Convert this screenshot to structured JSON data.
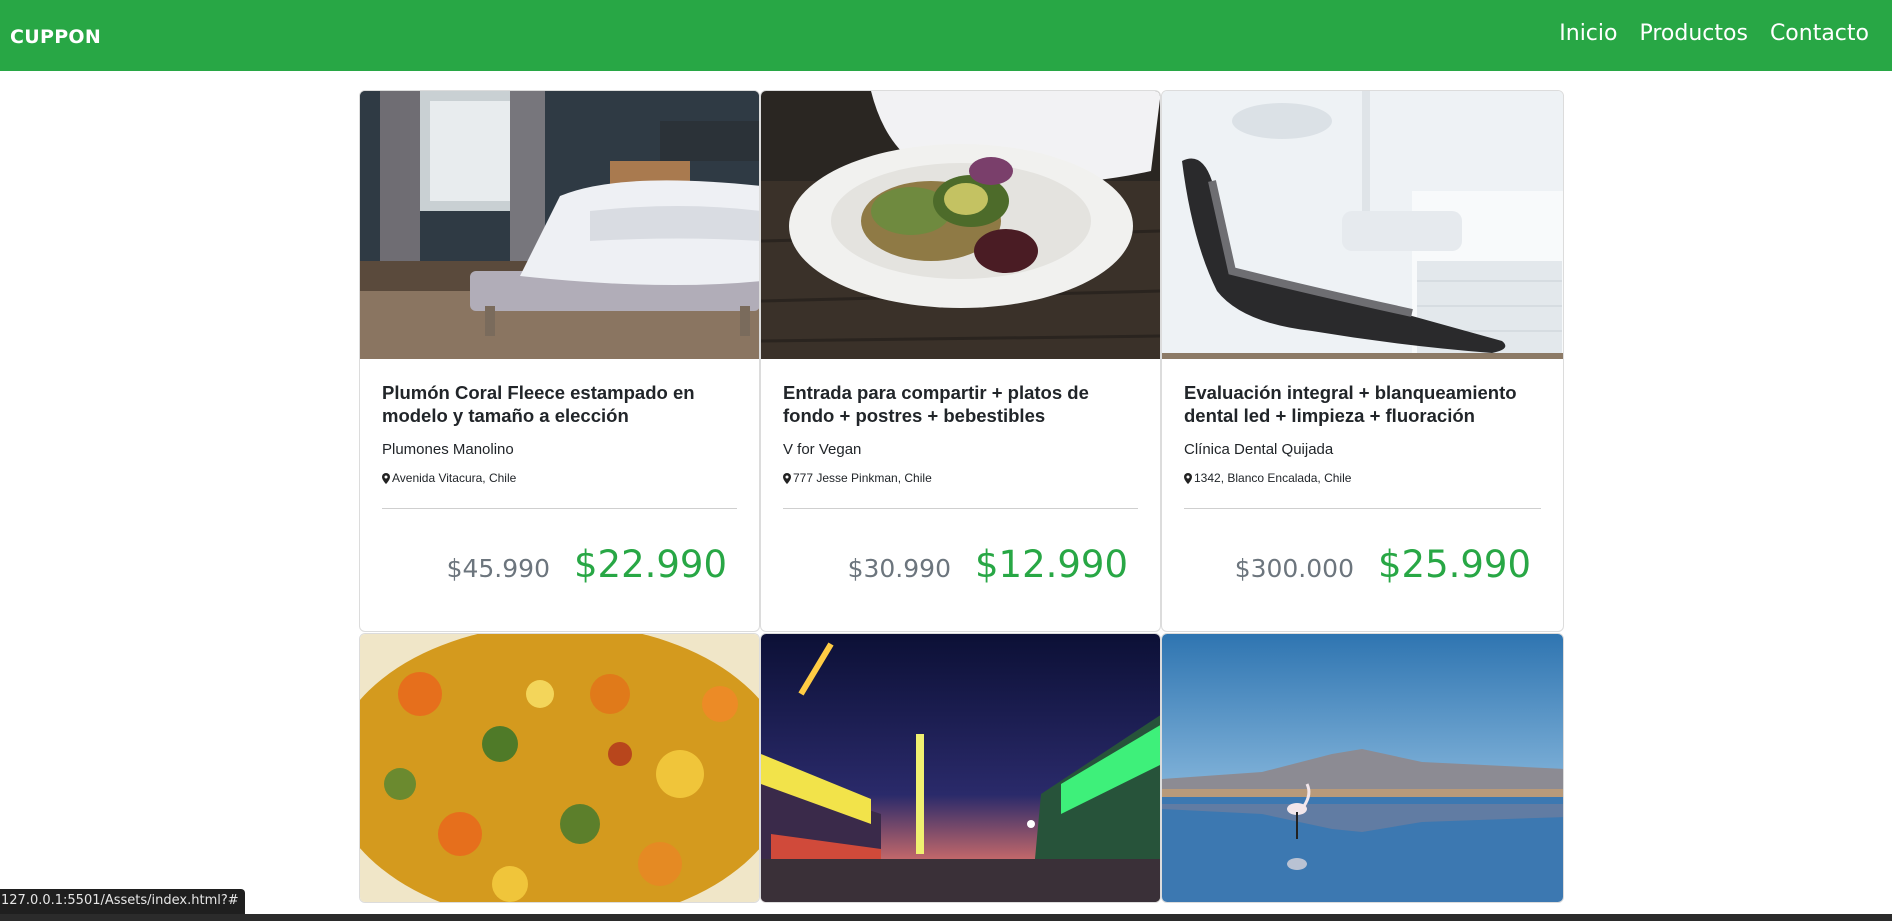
{
  "navbar": {
    "brand": "CUPPON",
    "links": [
      "Inicio",
      "Productos",
      "Contacto"
    ],
    "color": "#28a745"
  },
  "cards": [
    {
      "image": "bedroom photo",
      "title": "Plumón Coral Fleece estampado en modelo y tamaño a elección",
      "store": "Plumones Manolino",
      "location": "Avenida Vitacura, Chile",
      "old_price": "$45.990",
      "new_price": "$22.990"
    },
    {
      "image": "vegan food plate photo",
      "title": "Entrada para compartir + platos de fondo + postres + bebestibles",
      "store": "V for Vegan",
      "location": "777 Jesse Pinkman, Chile",
      "old_price": "$30.990",
      "new_price": "$12.990"
    },
    {
      "image": "dental chair photo",
      "title": "Evaluación integral + blanqueamiento dental led + limpieza + fluoración",
      "store": "Clínica Dental Quijada",
      "location": "1342, Blanco Encalada, Chile",
      "old_price": "$300.000",
      "new_price": "$25.990"
    },
    {
      "image": "vegetable stew photo"
    },
    {
      "image": "amusement park night photo"
    },
    {
      "image": "flamingo lagoon photo"
    }
  ],
  "status_url": "127.0.0.1:5501/Assets/index.html?#",
  "colors": {
    "accent": "#28a745",
    "old_price": "#6c757d"
  }
}
